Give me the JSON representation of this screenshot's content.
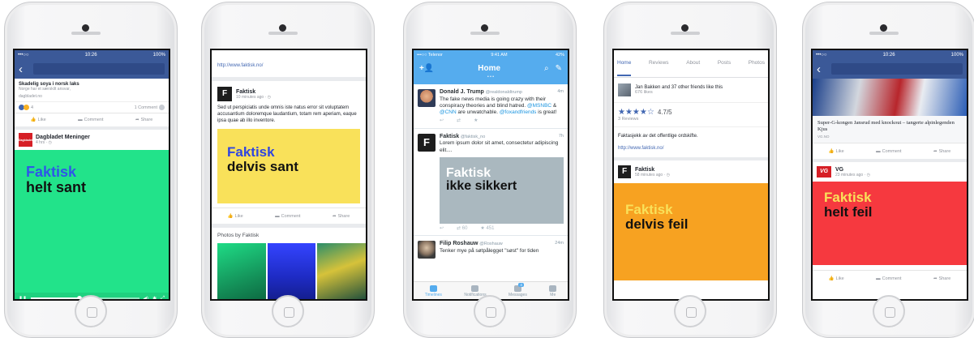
{
  "phone1": {
    "status": {
      "carrier": "•••○○",
      "time": "10:26",
      "battery": "100%"
    },
    "link_card": {
      "title": "Skadelig soya i norsk laks",
      "desc": "Norge har et særskilt ansvar,",
      "domain": "dagbladet.no"
    },
    "reactions": {
      "count": "4",
      "comments": "1 Comment"
    },
    "actions": {
      "like": "Like",
      "comment": "Comment",
      "share": "Share"
    },
    "post": {
      "author": "Dagbladet Meninger",
      "author_logo": "Dagbladet",
      "time": "4 hrs · ◷"
    },
    "art": {
      "l1": "Faktisk",
      "l2": "helt sant",
      "bg": "#22e38a",
      "l1_color": "#2f56e8",
      "l2_color": "#111111"
    },
    "video": {
      "progress": 0.45
    }
  },
  "phone2": {
    "link": "http://www.faktisk.no/",
    "post": {
      "author": "Faktisk",
      "time": "10 minutes ago · ◷",
      "text": "Sed ut perspiciatis unde omnis iste natus error sit voluptatem accusantium doloremque laudantium, totam rem aperiam, eaque ipsa quae ab illo inventore."
    },
    "art": {
      "l1": "Faktisk",
      "l2": "delvis sant",
      "bg": "#f9e15a",
      "l1_color": "#2f45e0",
      "l2_color": "#111111"
    },
    "actions": {
      "like": "Like",
      "comment": "Comment",
      "share": "Share"
    },
    "photos_title": "Photos by Faktisk"
  },
  "phone3": {
    "status": {
      "carrier": "•••○○ Telenor",
      "time": "9:41 AM",
      "battery": "42%"
    },
    "title": "Home",
    "tweets": [
      {
        "name": "Donald J. Trump",
        "handle": "@realdonaldtrump",
        "time": "4m",
        "text_a": "The fake news media is going crazy with their conspiracy theories and blind hatred. ",
        "mention1": "@MSNBC",
        "and": " & ",
        "mention2": "@CNN",
        "text_b": " are unwatchable. ",
        "mention3": "@foxandfriends",
        "text_c": " is great!"
      },
      {
        "name": "Faktisk",
        "handle": "@faktisk_no",
        "time": "7h",
        "text": "Lorem ipsum dolor sit amet, consectetur adipiscing elit....",
        "retweets": "60",
        "likes": "451"
      },
      {
        "name": "Filip Roshauw",
        "handle": "@Roshauw",
        "time": "24m",
        "text": "Tenker mye på søtpålegget \"søst\" for tiden"
      }
    ],
    "art": {
      "l1": "Faktisk",
      "l2": "ikke sikkert",
      "bg": "#aab8bf",
      "l1_color": "#ffffff",
      "l2_color": "#111111"
    },
    "tabs": [
      {
        "label": "Timelines"
      },
      {
        "label": "Notifications"
      },
      {
        "label": "Messages",
        "badge": "4"
      },
      {
        "label": "Me"
      }
    ]
  },
  "phone4": {
    "tabs": [
      "Home",
      "Reviews",
      "About",
      "Posts",
      "Photos"
    ],
    "friends": {
      "text": "Jan Bakken and 37 other friends like this",
      "likes": "676 likes"
    },
    "rating": {
      "value": "4.7/5",
      "reviews": "3 Reviews"
    },
    "about": "Faktasjekk av det offentlige ordskifte.",
    "link": "http://www.faktisk.no/",
    "post": {
      "author": "Faktisk",
      "time": "58 minutes ago · ◷"
    },
    "art": {
      "l1": "Faktisk",
      "l2": "delvis feil",
      "bg": "#f7a221",
      "l1_color": "#f9e15a",
      "l2_color": "#111111"
    }
  },
  "phone5": {
    "status": {
      "carrier": "•••○○",
      "time": "10:26",
      "battery": "100%"
    },
    "article": {
      "title": "Super-G-kongen Jansrud med knockout – tangerte alpinlegenden Kjus",
      "source": "VG.NO"
    },
    "actions": {
      "like": "Like",
      "comment": "Comment",
      "share": "Share"
    },
    "post": {
      "author": "VG",
      "time": "23 minutes ago · ◷",
      "logo": "VG"
    },
    "art": {
      "l1": "Faktisk",
      "l2": "helt feil",
      "bg": "#f6393f",
      "l1_color": "#f9e15a",
      "l2_color": "#111111"
    }
  }
}
